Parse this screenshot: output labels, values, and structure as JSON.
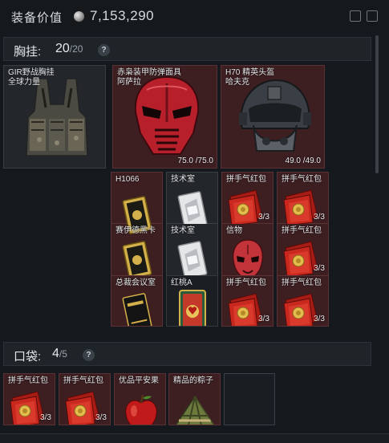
{
  "header": {
    "title": "装备价值",
    "value": "7,153,290"
  },
  "chest_section": {
    "label": "胸挂:",
    "count": "20",
    "capacity": "/20",
    "help": "?"
  },
  "pocket_section": {
    "label": "口袋:",
    "count": "4",
    "capacity": "/5",
    "help": "?"
  },
  "equipment": {
    "rig": {
      "name": "GIR野战胸挂",
      "sub": "全球力量"
    },
    "mask": {
      "name": "赤枭装甲防弹面具",
      "sub": "阿萨拉",
      "durability": "75.0 /75.0"
    },
    "helmet": {
      "name": "H70 精英头盔",
      "sub": "哈夫克",
      "durability": "49.0 /49.0"
    }
  },
  "chest_items": [
    {
      "name": "H1066",
      "qty": ""
    },
    {
      "name": "技术室",
      "qty": ""
    },
    {
      "name": "拼手气红包",
      "qty": "3/3"
    },
    {
      "name": "拼手气红包",
      "qty": "3/3"
    },
    {
      "name": "赛伊德黑卡",
      "qty": ""
    },
    {
      "name": "技术室",
      "qty": ""
    },
    {
      "name": "信物",
      "qty": ""
    },
    {
      "name": "拼手气红包",
      "qty": "3/3"
    },
    {
      "name": "总裁会议室",
      "qty": ""
    },
    {
      "name": "红桃A",
      "qty": ""
    },
    {
      "name": "拼手气红包",
      "qty": "3/3"
    },
    {
      "name": "拼手气红包",
      "qty": "3/3"
    }
  ],
  "pocket_items": [
    {
      "name": "拼手气红包",
      "qty": "3/3"
    },
    {
      "name": "拼手气红包",
      "qty": "3/3"
    },
    {
      "name": "优品平安果",
      "qty": ""
    },
    {
      "name": "精品的粽子",
      "qty": ""
    }
  ],
  "colors": {
    "red_slot": "#3d1f22",
    "gray_slot": "#23272b",
    "envelope_red": "#c8281e",
    "gold": "#d4b04a"
  }
}
